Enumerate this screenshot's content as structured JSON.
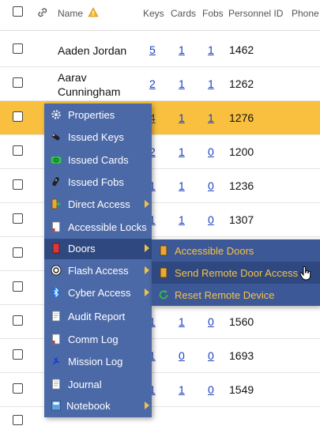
{
  "header": {
    "name": "Name",
    "keys": "Keys",
    "cards": "Cards",
    "fobs": "Fobs",
    "personnel_id": "Personnel ID",
    "phone": "Phone"
  },
  "rows": [
    {
      "name": "Aaden Jordan",
      "keys": "5",
      "cards": "1",
      "fobs": "1",
      "pid": "1462"
    },
    {
      "name": "Aarav Cunningham",
      "keys": "2",
      "cards": "1",
      "fobs": "1",
      "pid": "1262"
    },
    {
      "name": "",
      "keys": "4",
      "cards": "1",
      "fobs": "1",
      "pid": "1276"
    },
    {
      "name": "",
      "keys": "2",
      "cards": "1",
      "fobs": "0",
      "pid": "1200"
    },
    {
      "name": "",
      "keys": "1",
      "cards": "1",
      "fobs": "0",
      "pid": "1236"
    },
    {
      "name": "",
      "keys": "1",
      "cards": "1",
      "fobs": "0",
      "pid": "1307"
    },
    {
      "name": "",
      "keys": "",
      "cards": "",
      "fobs": "",
      "pid": ""
    },
    {
      "name": "",
      "keys": "",
      "cards": "",
      "fobs": "",
      "pid": ""
    },
    {
      "name": "",
      "keys": "1",
      "cards": "1",
      "fobs": "0",
      "pid": "1560"
    },
    {
      "name": "",
      "keys": "1",
      "cards": "0",
      "fobs": "0",
      "pid": "1693"
    },
    {
      "name": "",
      "keys": "1",
      "cards": "1",
      "fobs": "0",
      "pid": "1549"
    }
  ],
  "context_menu": {
    "items": [
      {
        "label": "Properties",
        "icon": "gear-icon"
      },
      {
        "label": "Issued Keys",
        "icon": "key-icon"
      },
      {
        "label": "Issued Cards",
        "icon": "card-icon"
      },
      {
        "label": "Issued Fobs",
        "icon": "fob-icon"
      },
      {
        "label": "Direct Access",
        "icon": "direct-access-icon"
      },
      {
        "label": "Accessible Locks",
        "icon": "document-icon"
      },
      {
        "label": "Doors",
        "icon": "door-icon"
      },
      {
        "label": "Flash Access",
        "icon": "flash-icon"
      },
      {
        "label": "Cyber Access",
        "icon": "bluetooth-icon"
      },
      {
        "label": "Audit Report",
        "icon": "report-icon"
      },
      {
        "label": "Comm Log",
        "icon": "log-icon"
      },
      {
        "label": "Mission Log",
        "icon": "mission-icon"
      },
      {
        "label": "Journal",
        "icon": "journal-icon"
      },
      {
        "label": "Notebook",
        "icon": "notebook-icon"
      }
    ]
  },
  "submenu": {
    "items": [
      {
        "label": "Accessible Doors",
        "icon": "door-icon"
      },
      {
        "label": "Send Remote Door Access",
        "icon": "door-icon"
      },
      {
        "label": "Reset Remote Device",
        "icon": "refresh-icon"
      }
    ]
  },
  "colors": {
    "highlight_row": "#f8c03e",
    "menu_bg": "#4c69a7",
    "menu_active": "#2f4980",
    "submenu_text": "#f5c24a",
    "link": "#1a3fbf"
  }
}
